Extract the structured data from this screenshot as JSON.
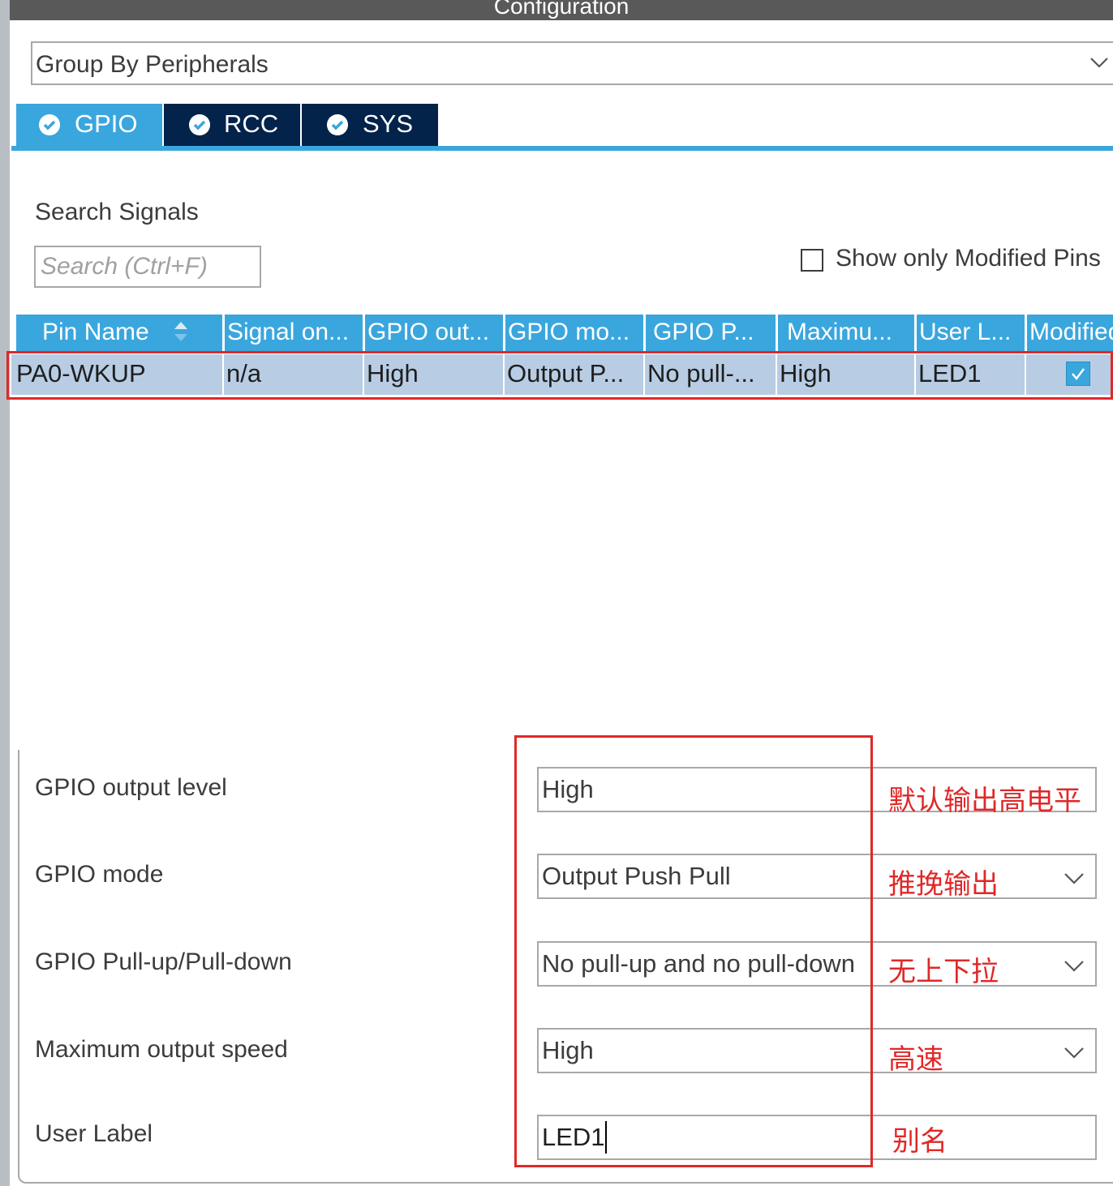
{
  "window": {
    "title": "Configuration"
  },
  "group_by": {
    "value": "Group By Peripherals"
  },
  "tabs": [
    {
      "label": "GPIO",
      "active": true
    },
    {
      "label": "RCC",
      "active": false
    },
    {
      "label": "SYS",
      "active": false
    }
  ],
  "search": {
    "label": "Search Signals",
    "placeholder": "Search (Ctrl+F)",
    "show_modified_label": "Show only Modified Pins",
    "show_modified_checked": false
  },
  "table": {
    "columns": [
      "Pin Name",
      "Signal on...",
      "GPIO out...",
      "GPIO mo...",
      "GPIO P...",
      "Maximu...",
      "User L...",
      "Modified"
    ],
    "rows": [
      {
        "pin": "PA0-WKUP",
        "signal": "n/a",
        "out": "High",
        "mode": "Output P...",
        "pull": "No pull-...",
        "speed": "High",
        "label": "LED1",
        "modified": true
      }
    ]
  },
  "properties": [
    {
      "label": "GPIO output level",
      "value": "High",
      "note": "默认输出高电平",
      "dropdown": false
    },
    {
      "label": "GPIO mode",
      "value": "Output Push Pull",
      "note": "推挽输出",
      "dropdown": true
    },
    {
      "label": "GPIO Pull-up/Pull-down",
      "value": "No pull-up and no pull-down",
      "note": "无上下拉",
      "dropdown": true
    },
    {
      "label": "Maximum output speed",
      "value": "High",
      "note": "高速",
      "dropdown": true
    },
    {
      "label": "User Label",
      "value": "LED1",
      "note": "别名",
      "dropdown": false
    }
  ],
  "colors": {
    "accent": "#3aa6de",
    "tab_dark": "#03234b",
    "selected_row": "#b8cde4",
    "annotation_red": "#e02828"
  }
}
